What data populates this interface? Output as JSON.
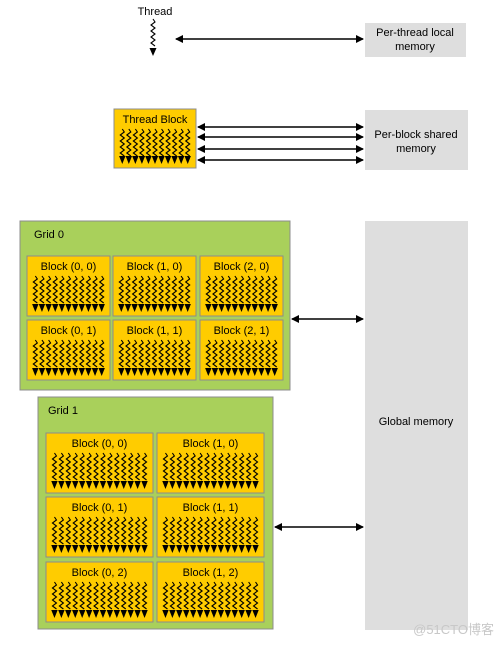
{
  "thread": {
    "label": "Thread"
  },
  "thread_block": {
    "label": "Thread Block"
  },
  "memory": {
    "local": [
      "Per-thread local",
      "memory"
    ],
    "shared": [
      "Per-block shared",
      "memory"
    ],
    "global": "Global memory"
  },
  "grids": [
    {
      "label": "Grid 0",
      "blocks": [
        "Block (0, 0)",
        "Block (1, 0)",
        "Block (2, 0)",
        "Block (0, 1)",
        "Block (1, 1)",
        "Block (2, 1)"
      ]
    },
    {
      "label": "Grid 1",
      "blocks": [
        "Block (0, 0)",
        "Block (1, 0)",
        "Block (0, 1)",
        "Block (1, 1)",
        "Block (0, 2)",
        "Block (1, 2)"
      ]
    }
  ],
  "watermark": "@51CTO博客",
  "colors": {
    "block": "#FFCC00",
    "grid": "#A9D05B",
    "memory": "#DEDEDE",
    "border": "#8C8C8C"
  }
}
